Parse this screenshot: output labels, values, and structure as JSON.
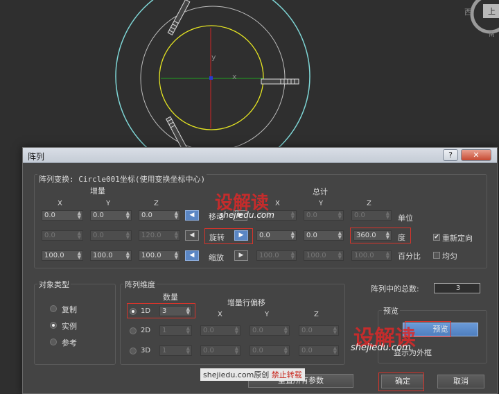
{
  "viewport": {
    "labels": {
      "axis_y": "y",
      "axis_x": "x",
      "viewcube_top": "上",
      "viewcube_left": "西",
      "viewcube_right": "南"
    }
  },
  "dialog": {
    "title": "阵列",
    "help_label": "?",
    "close_label": "✕",
    "transform": {
      "header": "阵列变换: Circle001坐标(使用变换坐标中心)",
      "increment_label": "增量",
      "total_label": "总计",
      "axes": [
        "X",
        "Y",
        "Z"
      ],
      "units_label": "单位",
      "degrees_label": "度",
      "percent_label": "百分比",
      "reorient_label": "重新定向",
      "reorient_checked": true,
      "uniform_label": "均匀",
      "uniform_checked": false,
      "rows": [
        {
          "name": "move",
          "label": "移动",
          "inc": [
            "0.0",
            "0.0",
            "0.0"
          ],
          "tot": [
            "0.0",
            "0.0",
            "0.0"
          ],
          "inc_enabled": true,
          "tot_enabled": false
        },
        {
          "name": "rotate",
          "label": "旋转",
          "inc": [
            "0.0",
            "0.0",
            "120.0"
          ],
          "tot": [
            "0.0",
            "0.0",
            "360.0"
          ],
          "inc_enabled": false,
          "tot_enabled": true
        },
        {
          "name": "scale",
          "label": "缩放",
          "inc": [
            "100.0",
            "100.0",
            "100.0"
          ],
          "tot": [
            "100.0",
            "100.0",
            "100.0"
          ],
          "inc_enabled": true,
          "tot_enabled": false
        }
      ]
    },
    "object_type": {
      "title": "对象类型",
      "options": [
        "复制",
        "实例",
        "参考"
      ],
      "selected": 1
    },
    "array_dim": {
      "title": "阵列维度",
      "count_label": "数量",
      "offset_label": "增量行偏移",
      "axes": [
        "X",
        "Y",
        "Z"
      ],
      "rows": [
        {
          "label": "1D",
          "count": "3",
          "offsets": []
        },
        {
          "label": "2D",
          "count": "1",
          "offsets": [
            "0.0",
            "0.0",
            "0.0"
          ]
        },
        {
          "label": "3D",
          "count": "1",
          "offsets": [
            "0.0",
            "0.0",
            "0.0"
          ]
        }
      ],
      "selected": 0
    },
    "total_count_label": "阵列中的总数:",
    "total_count_value": "3",
    "preview": {
      "title": "预览",
      "button_label": "预览",
      "bbox_label": "显示为外框"
    },
    "reset_label": "重置所有参数",
    "ok_label": "确定",
    "cancel_label": "取消"
  },
  "watermark": {
    "logo": "设解读",
    "site": "shejiedu.com",
    "bar_site": "shejiedu.com原创",
    "bar_note": "禁止转载"
  },
  "colors": {
    "highlight_box": "#d9342b",
    "accent_blue": "#5a86c4",
    "dialog_bg": "#444444",
    "viewport_bg": "#2f2f2f"
  }
}
